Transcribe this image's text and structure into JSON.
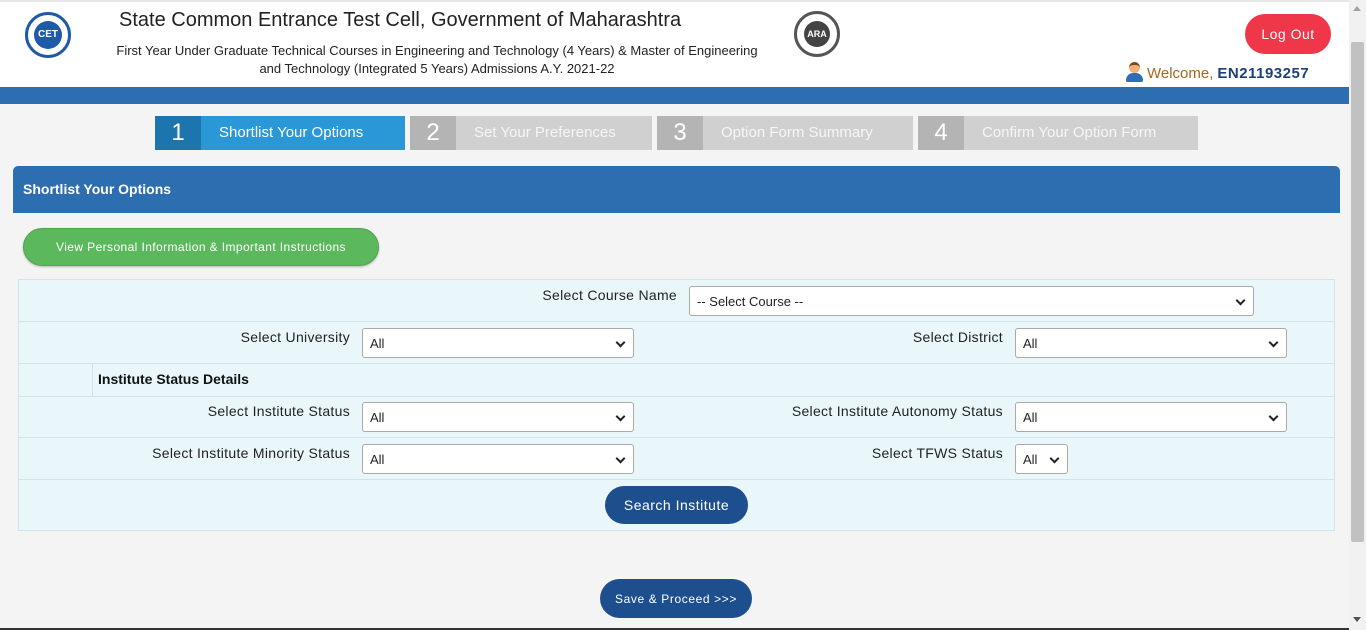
{
  "header": {
    "logo_left_text": "CET",
    "title": "State Common Entrance Test Cell, Government of Maharashtra",
    "subtitle": "First Year Under Graduate Technical Courses in Engineering and Technology (4 Years) & Master of Engineering and Technology (Integrated 5 Years) Admissions A.Y. 2021-22",
    "logo_right_text": "ARA",
    "logout_label": "Log Out",
    "welcome_label": "Welcome,",
    "user_id": "EN21193257"
  },
  "steps": [
    {
      "num": "1",
      "label": "Shortlist Your Options",
      "active": true
    },
    {
      "num": "2",
      "label": "Set Your Preferences",
      "active": false
    },
    {
      "num": "3",
      "label": "Option Form Summary",
      "active": false
    },
    {
      "num": "4",
      "label": "Confirm Your Option Form",
      "active": false
    }
  ],
  "panel": {
    "title": "Shortlist Your Options",
    "info_button_label": "View Personal Information & Important Instructions"
  },
  "form": {
    "course_label": "Select Course Name",
    "course_value": "-- Select Course --",
    "university_label": "Select University",
    "university_value": "All",
    "district_label": "Select District",
    "district_value": "All",
    "institute_status_heading": "Institute Status Details",
    "institute_status_label": "Select Institute Status",
    "institute_status_value": "All",
    "autonomy_label": "Select Institute Autonomy Status",
    "autonomy_value": "All",
    "minority_label": "Select Institute Minority Status",
    "minority_value": "All",
    "tfws_label": "Select TFWS Status",
    "tfws_value": "All",
    "search_label": "Search Institute"
  },
  "footer": {
    "save_label": "Save & Proceed >>>"
  },
  "colors": {
    "primary_blue": "#2d6eb0",
    "active_step": "#2a98d6",
    "inactive_step": "#d0d0d0",
    "logout": "#f0374a",
    "green": "#5cb85c",
    "navy_button": "#1d4f8e",
    "form_bg": "#e9f7fb"
  }
}
